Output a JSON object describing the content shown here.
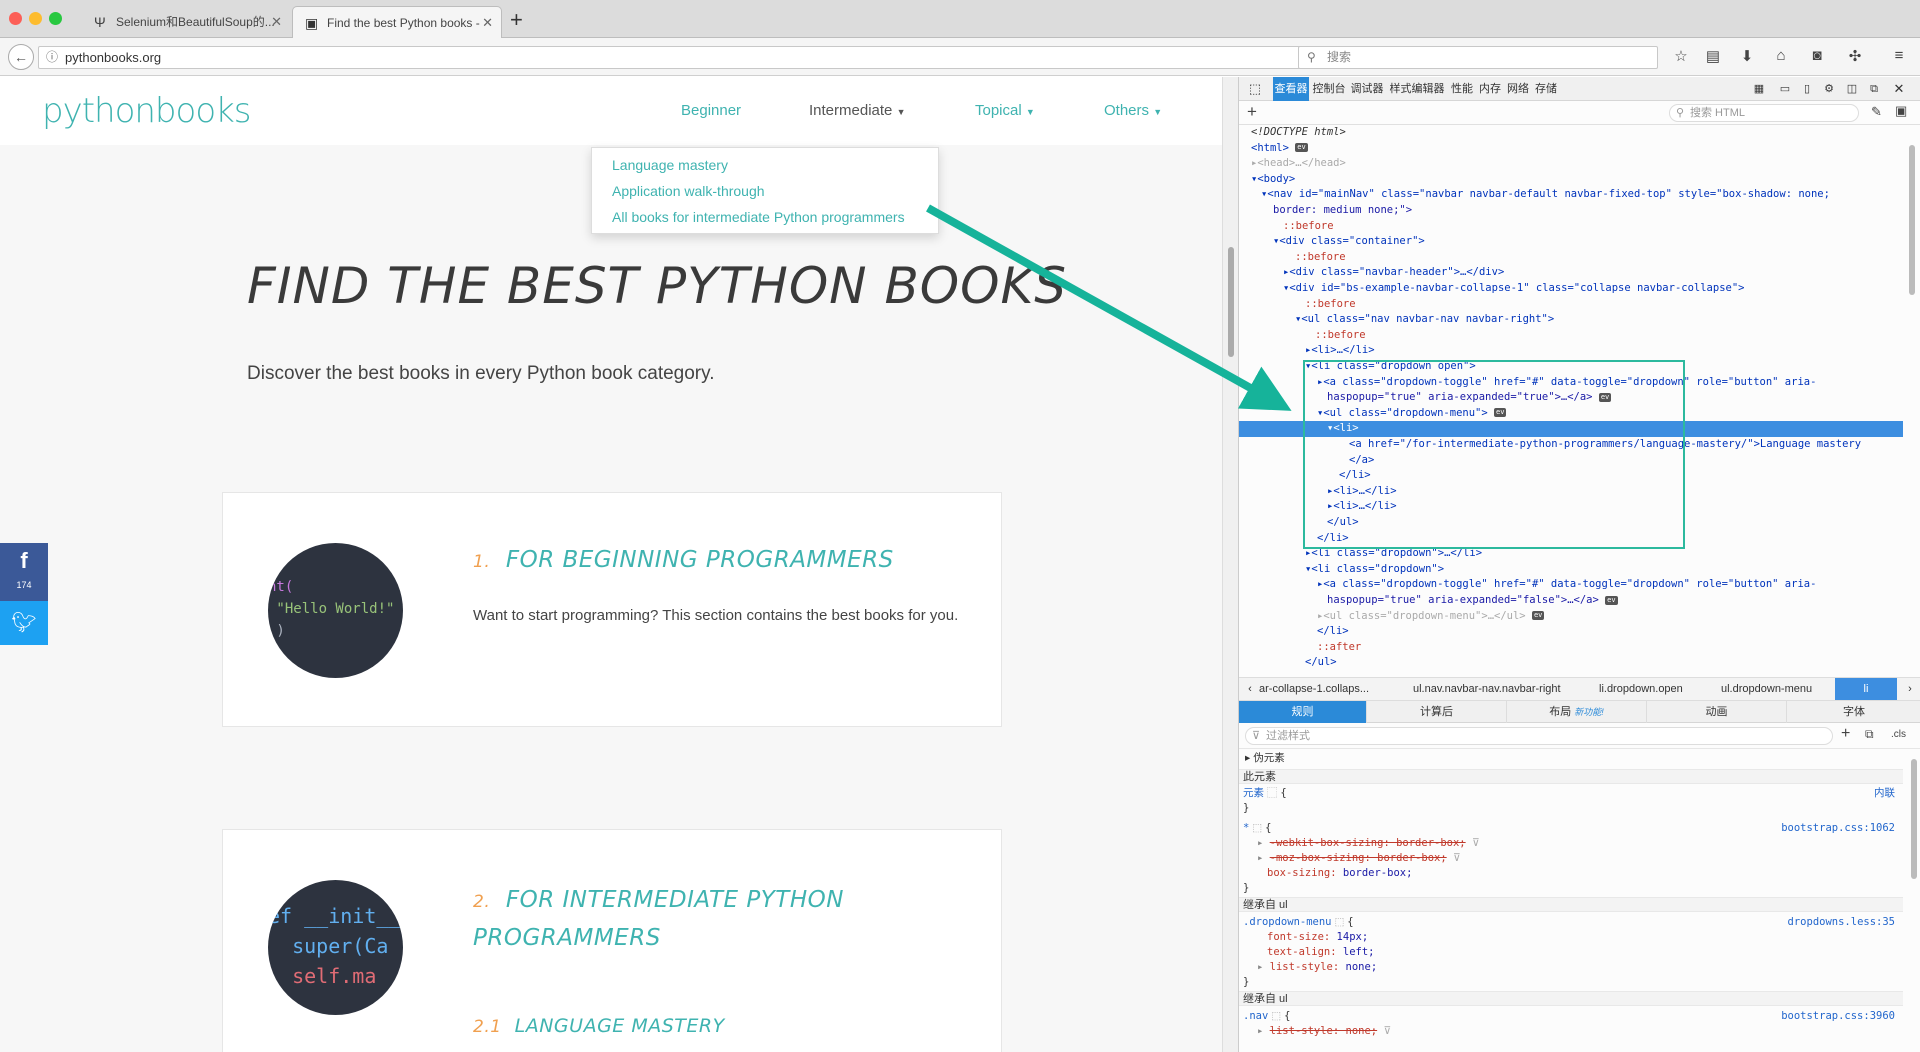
{
  "browser": {
    "tabs": [
      {
        "title": "Selenium和BeautifulSoup的..."
      },
      {
        "title": "Find the best Python books -"
      }
    ],
    "url": "pythonbooks.org",
    "search_placeholder": "搜索"
  },
  "site": {
    "logo": "pythonbooks",
    "nav": [
      {
        "label": "Beginner",
        "dropdown": false
      },
      {
        "label": "Intermediate",
        "dropdown": true
      },
      {
        "label": "Topical",
        "dropdown": true
      },
      {
        "label": "Others",
        "dropdown": true
      }
    ],
    "dropdown_items": [
      "Language mastery",
      "Application walk-through",
      "All books for intermediate Python programmers"
    ],
    "hero_title": "FIND THE BEST PYTHON BOOKS",
    "hero_subtitle": "Discover the best books in every Python book category.",
    "social": {
      "facebook_count": "174"
    },
    "cards": [
      {
        "number": "1.",
        "title": "FOR BEGINNING PROGRAMMERS",
        "description": "Want to start programming? This section contains the best books for you.",
        "code_lines": [
          "nt(",
          " \"Hello World!\"",
          " )"
        ]
      },
      {
        "number": "2.",
        "title_line1": "FOR INTERMEDIATE PYTHON",
        "title_line2": "PROGRAMMERS",
        "sub_number": "2.1",
        "sub_title": "LANGUAGE MASTERY",
        "code_lines": [
          "ef __init__",
          "  super(Ca",
          "  self.ma"
        ]
      }
    ]
  },
  "devtools": {
    "tabs": [
      "查看器",
      "控制台",
      "调试器",
      "样式编辑器",
      "性能",
      "内存",
      "网络",
      "存储"
    ],
    "html_search_placeholder": "搜索 HTML",
    "tree": [
      "<!DOCTYPE html>",
      "<html>",
      "<head>…</head>",
      "<body>",
      "<nav id=\"mainNav\" class=\"navbar navbar-default navbar-fixed-top\" style=\"box-shadow: none;",
      "border: medium none;\">",
      "::before",
      "<div class=\"container\">",
      "::before",
      "<div class=\"navbar-header\">…</div>",
      "<div id=\"bs-example-navbar-collapse-1\" class=\"collapse navbar-collapse\">",
      "::before",
      "<ul class=\"nav navbar-nav navbar-right\">",
      "::before",
      "<li>…</li>",
      "<li class=\"dropdown open\">",
      "<a class=\"dropdown-toggle\" href=\"#\" data-toggle=\"dropdown\" role=\"button\" aria-",
      "haspopup=\"true\" aria-expanded=\"true\">…</a>",
      "<ul class=\"dropdown-menu\">",
      "<li>",
      "<a href=\"/for-intermediate-python-programmers/language-mastery/\">Language mastery",
      "</a>",
      "</li>",
      "<li>…</li>",
      "<li>…</li>",
      "</ul>",
      "</li>",
      "<li class=\"dropdown\">…</li>",
      "<li class=\"dropdown\">",
      "<a class=\"dropdown-toggle\" href=\"#\" data-toggle=\"dropdown\" role=\"button\" aria-",
      "haspopup=\"true\" aria-expanded=\"false\">…</a>",
      "<ul class=\"dropdown-menu\">…</ul>",
      "</li>",
      "::after",
      "</ul>"
    ],
    "breadcrumbs": [
      "ar-collapse-1.collaps...",
      "ul.nav.navbar-nav.navbar-right",
      "li.dropdown.open",
      "ul.dropdown-menu",
      "li"
    ],
    "subtabs": [
      "规则",
      "计算后",
      "布局",
      "动画",
      "字体"
    ],
    "new_feature_label": "新功能!",
    "filter_placeholder": "过滤样式",
    "cls_label": ".cls",
    "rules": {
      "pseudo_label": "伪元素",
      "this_element": "此元素",
      "element_selector": "元素",
      "inline_label": "内联",
      "universal_selector": "*",
      "bootstrap_src1": "bootstrap.css:1062",
      "webkit_prop": "-webkit-box-sizing: border-box;",
      "moz_prop": "-moz-box-sizing: border-box;",
      "box_prop": "box-sizing:",
      "box_val": "border-box;",
      "inherited1": "继承自 ul",
      "dropdown_selector": ".dropdown-menu",
      "dropdown_src": "dropdowns.less:35",
      "fs_prop": "font-size:",
      "fs_val": "14px;",
      "ta_prop": "text-align:",
      "ta_val": "left;",
      "ls_prop": "list-style:",
      "ls_val": "none;",
      "inherited2": "继承自 ul",
      "nav_selector": ".nav",
      "bootstrap_src2": "bootstrap.css:3960",
      "ls2_prop": "list-style: none;"
    }
  }
}
